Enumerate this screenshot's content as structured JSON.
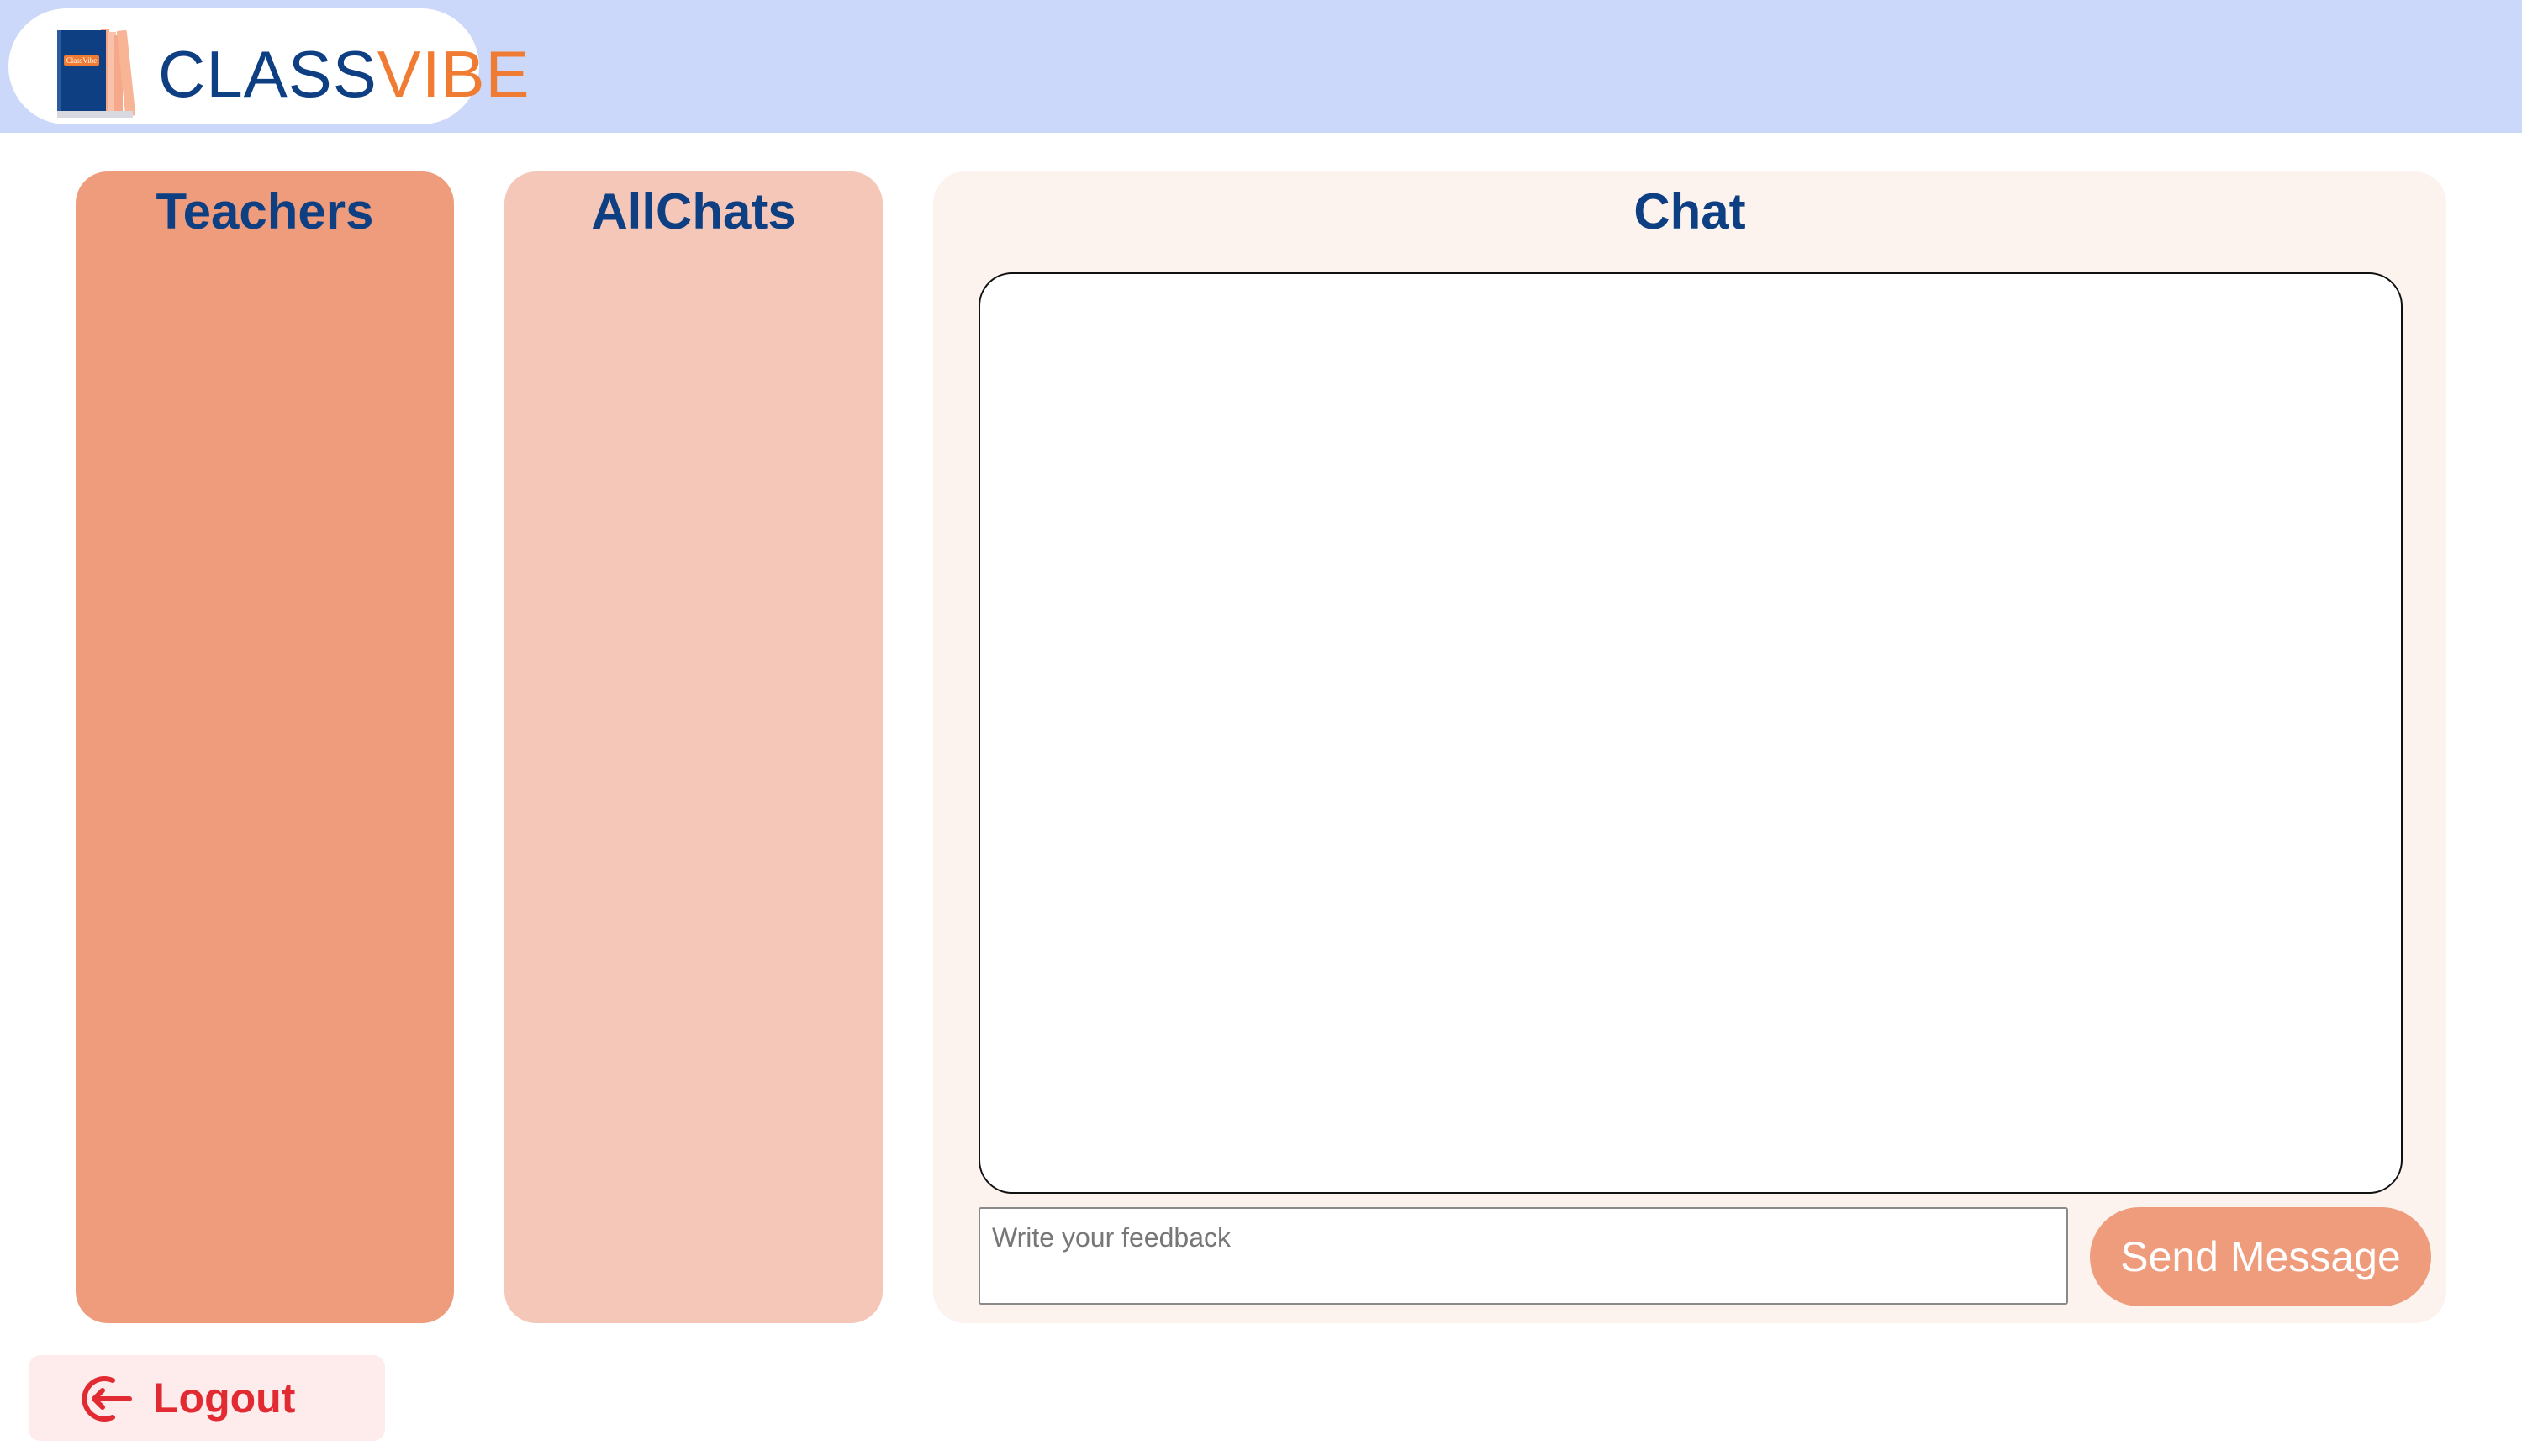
{
  "header": {
    "logo": {
      "icon": "book-icon",
      "book_cover_text": "ClassVibe",
      "text_primary": "CLASS",
      "text_accent": "VIBE",
      "color_primary": "#0d3f82",
      "color_accent": "#f07c33"
    },
    "background": "#ccd8fa"
  },
  "teachers_panel": {
    "title": "Teachers",
    "background": "#ee9c7c"
  },
  "allchats_panel": {
    "title": "AllChats",
    "background": "#f5c7b8"
  },
  "chat_panel": {
    "title": "Chat",
    "background": "#fcf2ee",
    "feedback_placeholder": "Write your feedback",
    "feedback_value": "",
    "send_label": "Send Message"
  },
  "logout": {
    "label": "Logout",
    "icon": "logout-icon",
    "color": "#e22a33"
  }
}
